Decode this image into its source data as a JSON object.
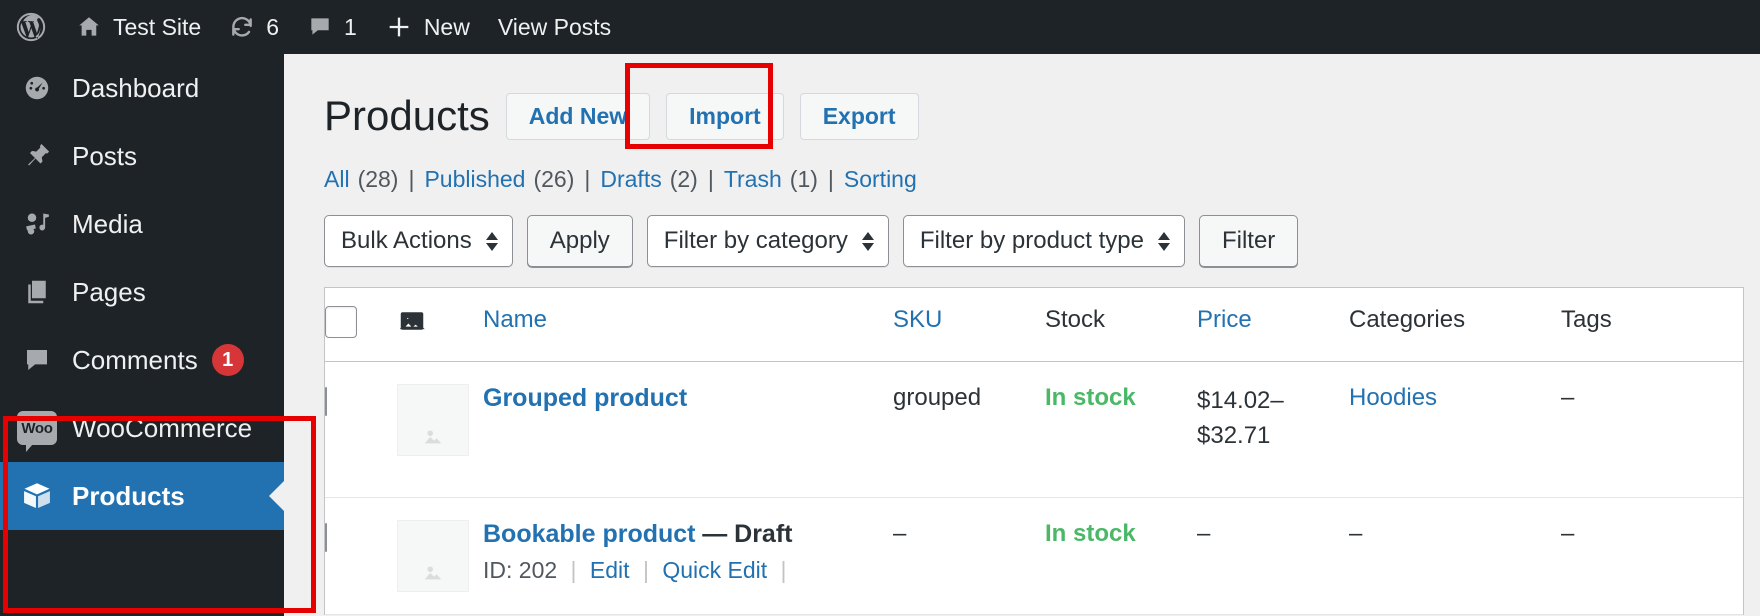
{
  "adminbar": {
    "logo_icon": "wordpress-logo-icon",
    "site": {
      "icon": "home-icon",
      "label": "Test Site"
    },
    "updates": {
      "icon": "updates-icon",
      "count": "6"
    },
    "comments": {
      "icon": "comment-icon",
      "count": "1"
    },
    "new": {
      "icon": "plus-icon",
      "label": "New"
    },
    "view_posts": {
      "label": "View Posts"
    }
  },
  "sidebar": {
    "items": [
      {
        "label": "Dashboard",
        "icon": "dashboard-icon",
        "current": false,
        "badge": ""
      },
      {
        "label": "Posts",
        "icon": "pin-icon",
        "current": false,
        "badge": ""
      },
      {
        "label": "Media",
        "icon": "media-icon",
        "current": false,
        "badge": ""
      },
      {
        "label": "Pages",
        "icon": "pages-icon",
        "current": false,
        "badge": ""
      },
      {
        "label": "Comments",
        "icon": "comment-icon",
        "current": false,
        "badge": "1"
      },
      {
        "label": "WooCommerce",
        "icon": "woocommerce-icon",
        "current": false,
        "badge": ""
      },
      {
        "label": "Products",
        "icon": "products-icon",
        "current": true,
        "badge": ""
      }
    ]
  },
  "page": {
    "title": "Products",
    "actions": [
      {
        "label": "Add New",
        "highlighted": false
      },
      {
        "label": "Import",
        "highlighted": true
      },
      {
        "label": "Export",
        "highlighted": false
      }
    ],
    "views": [
      {
        "label": "All",
        "count": "(28)"
      },
      {
        "label": "Published",
        "count": "(26)"
      },
      {
        "label": "Drafts",
        "count": "(2)"
      },
      {
        "label": "Trash",
        "count": "(1)"
      },
      {
        "label": "Sorting",
        "count": ""
      }
    ],
    "tablenav": {
      "bulk_actions": "Bulk Actions",
      "apply": "Apply",
      "filter_category": "Filter by category",
      "filter_product_type": "Filter by product type",
      "filter": "Filter"
    }
  },
  "table": {
    "columns": {
      "image_icon": "image-icon",
      "name": "Name",
      "sku": "SKU",
      "stock": "Stock",
      "price": "Price",
      "categories": "Categories",
      "tags": "Tags"
    },
    "rows": [
      {
        "name": "Grouped product",
        "status": "",
        "row_actions": [],
        "sku": "grouped",
        "stock": "In stock",
        "price_line1": "$14.02–",
        "price_line2": "$32.71",
        "categories": "Hoodies",
        "tags": "–"
      },
      {
        "name": "Bookable product",
        "status": "— Draft",
        "row_actions": [
          "ID: 202",
          "Edit",
          "Quick Edit"
        ],
        "sku": "–",
        "stock": "In stock",
        "price_line1": "–",
        "price_line2": "",
        "categories": "–",
        "tags": "–"
      }
    ]
  },
  "annotations": {
    "import_button_highlight": "red-box",
    "menu_highlight": "red-box"
  },
  "colors": {
    "admin_dark": "#1d2327",
    "accent_blue": "#2271b1",
    "instock_green": "#4ab866",
    "annotation_red": "#e60000",
    "badge_red": "#d63638"
  }
}
